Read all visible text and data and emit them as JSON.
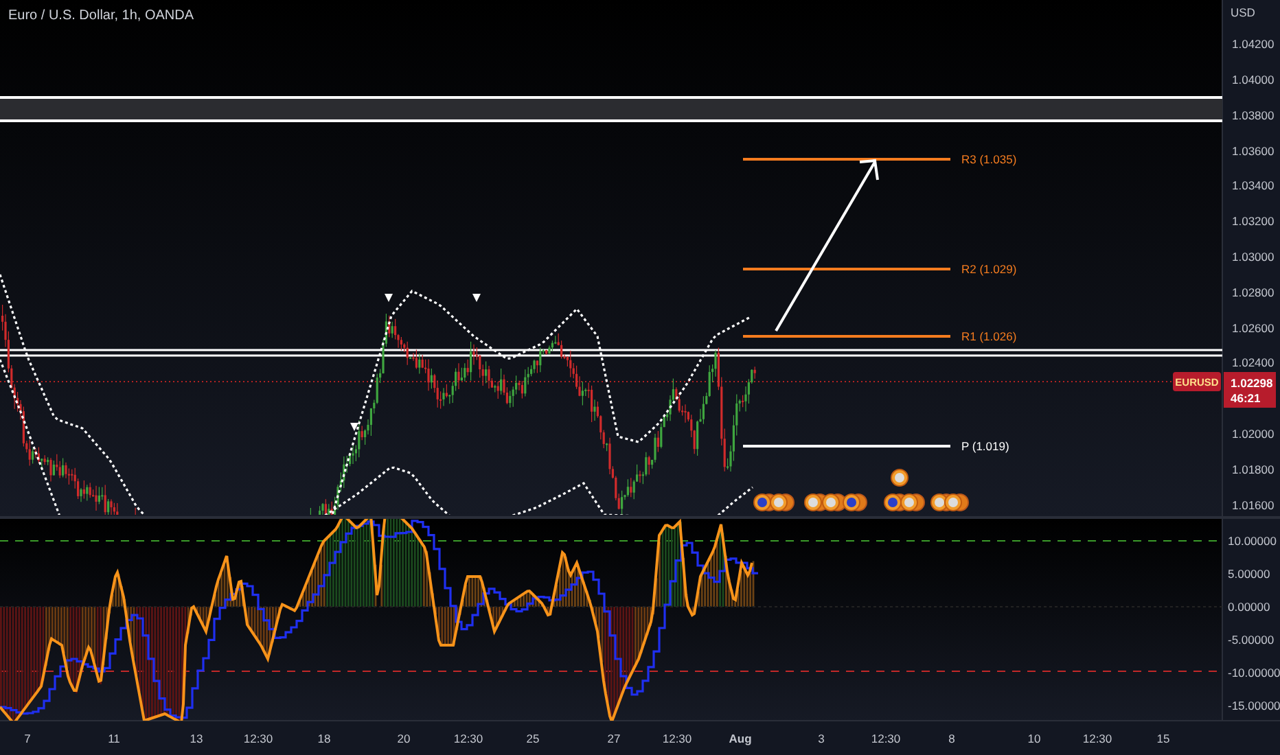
{
  "header": {
    "title": "Euro / U.S. Dollar, 1h, OANDA"
  },
  "price_axis": {
    "unit": "USD",
    "ticks": [
      "1.04200",
      "1.04000",
      "1.03800",
      "1.03600",
      "1.03400",
      "1.03200",
      "1.03000",
      "1.02800",
      "1.02600",
      "1.02400",
      "1.02000",
      "1.01800",
      "1.01600"
    ]
  },
  "price_label": {
    "symbol": "EURUSD",
    "price": "1.02298",
    "countdown": "46:21"
  },
  "pivots": [
    {
      "label": "R3 (1.035)",
      "kind": "resistance"
    },
    {
      "label": "R2 (1.029)",
      "kind": "resistance"
    },
    {
      "label": "R1 (1.026)",
      "kind": "resistance"
    },
    {
      "label": "P (1.019)",
      "kind": "pivot"
    }
  ],
  "oscillator_axis": {
    "ticks": [
      "10.00000",
      "5.00000",
      "0.00000",
      "-5.00000",
      "-10.00000",
      "-15.00000"
    ]
  },
  "time_axis": {
    "ticks": [
      {
        "label": "7",
        "kind": "day"
      },
      {
        "label": "11",
        "kind": "day"
      },
      {
        "label": "13",
        "kind": "day"
      },
      {
        "label": "12:30",
        "kind": "time"
      },
      {
        "label": "18",
        "kind": "day"
      },
      {
        "label": "20",
        "kind": "day"
      },
      {
        "label": "12:30",
        "kind": "time"
      },
      {
        "label": "25",
        "kind": "day"
      },
      {
        "label": "27",
        "kind": "day"
      },
      {
        "label": "12:30",
        "kind": "time"
      },
      {
        "label": "Aug",
        "kind": "month"
      },
      {
        "label": "3",
        "kind": "day"
      },
      {
        "label": "12:30",
        "kind": "time"
      },
      {
        "label": "8",
        "kind": "day"
      },
      {
        "label": "10",
        "kind": "day"
      },
      {
        "label": "12:30",
        "kind": "time"
      },
      {
        "label": "15",
        "kind": "day"
      }
    ]
  }
}
